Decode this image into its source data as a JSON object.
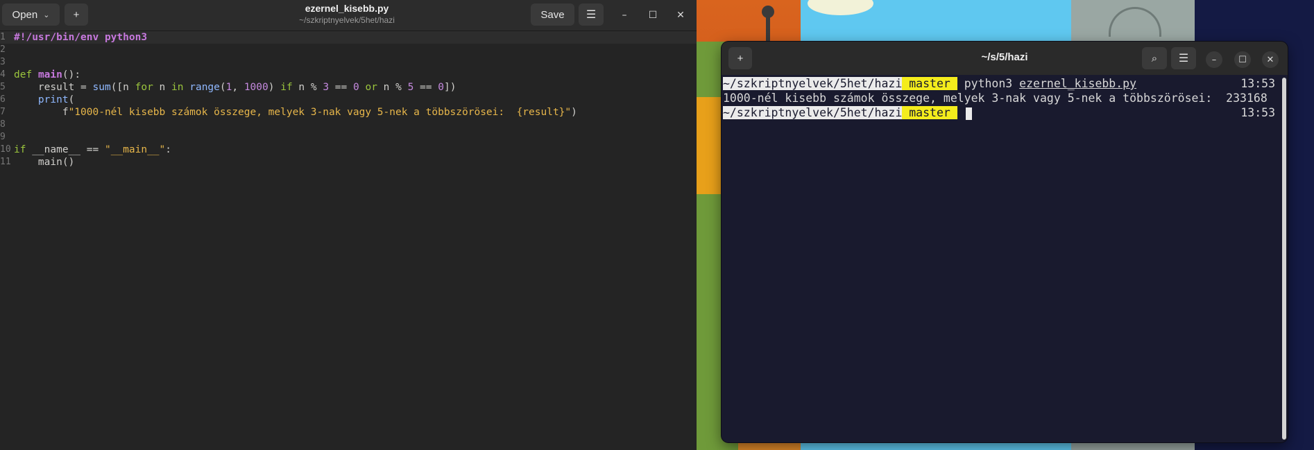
{
  "editor": {
    "title": "ezernel_kisebb.py",
    "subtitle": "~/szkriptnyelvek/5het/hazi",
    "open_label": "Open",
    "open_chevron": "⌄",
    "new_tab_icon": "+",
    "save_label": "Save",
    "menu_icon": "☰",
    "min_icon": "–",
    "max_icon": "☐",
    "close_icon": "✕",
    "lines": [
      {
        "n": "1",
        "parts": [
          {
            "t": "#!/usr/bin/env python3",
            "c": "sh"
          }
        ]
      },
      {
        "n": "2",
        "parts": []
      },
      {
        "n": "3",
        "parts": []
      },
      {
        "n": "4",
        "parts": [
          {
            "t": "def",
            "c": "k"
          },
          {
            "t": " "
          },
          {
            "t": "main",
            "c": "fn"
          },
          {
            "t": "():"
          }
        ]
      },
      {
        "n": "5",
        "parts": [
          {
            "t": "    result = "
          },
          {
            "t": "sum",
            "c": "f"
          },
          {
            "t": "([n "
          },
          {
            "t": "for",
            "c": "k"
          },
          {
            "t": " n "
          },
          {
            "t": "in",
            "c": "k"
          },
          {
            "t": " "
          },
          {
            "t": "range",
            "c": "f"
          },
          {
            "t": "("
          },
          {
            "t": "1",
            "c": "n"
          },
          {
            "t": ", "
          },
          {
            "t": "1000",
            "c": "n"
          },
          {
            "t": ") "
          },
          {
            "t": "if",
            "c": "k"
          },
          {
            "t": " n % "
          },
          {
            "t": "3",
            "c": "n"
          },
          {
            "t": " == "
          },
          {
            "t": "0",
            "c": "n"
          },
          {
            "t": " "
          },
          {
            "t": "or",
            "c": "k"
          },
          {
            "t": " n % "
          },
          {
            "t": "5",
            "c": "n"
          },
          {
            "t": " == "
          },
          {
            "t": "0",
            "c": "n"
          },
          {
            "t": "])"
          }
        ]
      },
      {
        "n": "6",
        "parts": [
          {
            "t": "    "
          },
          {
            "t": "print",
            "c": "f"
          },
          {
            "t": "("
          }
        ]
      },
      {
        "n": "7",
        "parts": [
          {
            "t": "        f"
          },
          {
            "t": "\"1000-nél kisebb számok összege, melyek 3-nak vagy 5-nek a többszörösei:  {result}\"",
            "c": "s"
          },
          {
            "t": ")"
          }
        ]
      },
      {
        "n": "8",
        "parts": []
      },
      {
        "n": "9",
        "parts": []
      },
      {
        "n": "10",
        "parts": [
          {
            "t": "if",
            "c": "k"
          },
          {
            "t": " __name__ == "
          },
          {
            "t": "\"__main__\"",
            "c": "s"
          },
          {
            "t": ":"
          }
        ]
      },
      {
        "n": "11",
        "parts": [
          {
            "t": "    main()"
          }
        ]
      }
    ]
  },
  "terminal": {
    "title": "~/s/5/hazi",
    "new_tab_icon": "+",
    "search_icon": "⌕",
    "menu_icon": "☰",
    "min_icon": "–",
    "max_icon": "☐",
    "close_icon": "✕",
    "line1_path": "~/szkriptnyelvek/5het/hazi",
    "line1_branch": " master ",
    "line1_cmd": " python3 ",
    "line1_file": "ezernel_kisebb.py",
    "line1_time": "13:53",
    "line2_output": "1000-nél kisebb számok összege, melyek 3-nak vagy 5-nek a többszörösei:  233168",
    "line3_path": "~/szkriptnyelvek/5het/hazi",
    "line3_branch": " master ",
    "line3_time": "13:53"
  },
  "colors": {
    "prompt_path_bg": "#ebebeb",
    "prompt_branch_bg": "#f4ec1c",
    "terminal_bg": "#191a2e",
    "editor_bg": "#242424"
  }
}
